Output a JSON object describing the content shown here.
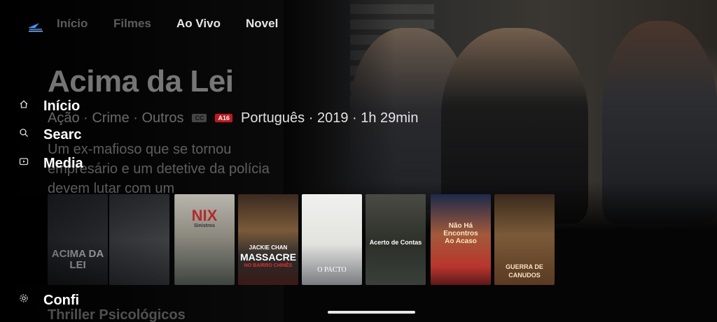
{
  "nav": {
    "tabs": [
      {
        "label": "Início",
        "active": false
      },
      {
        "label": "Filmes",
        "active": false
      },
      {
        "label": "Ao Vivo",
        "active": true
      },
      {
        "label": "Novel",
        "active": false
      }
    ]
  },
  "hero": {
    "title": "Acima da Lei",
    "genres": "Ação · Crime · Outros",
    "cc_badge": "CC",
    "age_badge": "A16",
    "info": "Português · 2019 · 1h 29min",
    "description": "Um ex-mafioso que se tornou empresário e um detetive da polícia devem lutar com um"
  },
  "sidemenu": {
    "items": [
      {
        "label": "Início",
        "icon": "home-icon"
      },
      {
        "label": "Search",
        "icon": "search-icon"
      },
      {
        "label": "Media",
        "icon": "media-icon"
      },
      {
        "label": "Confi",
        "icon": "gear-icon"
      }
    ]
  },
  "row": {
    "posters": [
      {
        "title": "ACIMA DA LEI"
      },
      {
        "title": ""
      },
      {
        "title": "NIX",
        "subtitle": "Sinistros"
      },
      {
        "title": "MASSACRE",
        "subtitle": "JACKIE CHAN",
        "extra": "NO BAIRRO CHINÊS"
      },
      {
        "title": "O PACTO"
      },
      {
        "title": "Acerto de Contas"
      },
      {
        "title": "Não Há Encontros Ao Acaso"
      },
      {
        "title": "GUERRA DE CANUDOS"
      }
    ]
  },
  "section": {
    "title": "Thriller Psicológicos"
  },
  "colors": {
    "age_badge": "#c8141c",
    "background": "#050505"
  }
}
